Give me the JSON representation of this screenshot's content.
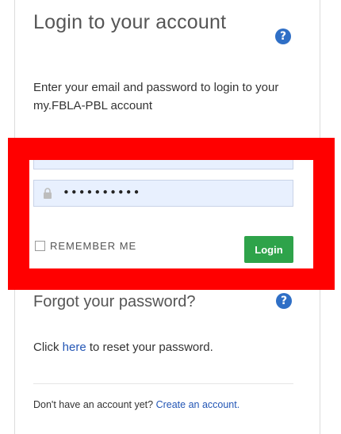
{
  "login": {
    "title": "Login to your account",
    "help_glyph": "?",
    "intro": "Enter your email and password to login to your my.FBLA-PBL account"
  },
  "form": {
    "email_value": "",
    "password_mask": "••••••••••",
    "remember_label": "REMEMBER ME",
    "login_label": "Login"
  },
  "forgot": {
    "title": "Forgot your password?",
    "help_glyph": "?",
    "prefix": "Click ",
    "link": "here",
    "suffix": " to reset your password."
  },
  "signup": {
    "prompt": "Don't have an account yet? ",
    "link": "Create an account."
  },
  "icons": {
    "help": "question-circle-icon",
    "lock": "lock-icon"
  },
  "colors": {
    "highlight": "#ff0000",
    "button": "#2ea34a",
    "link": "#2356b5",
    "help_icon": "#2f6fc6"
  }
}
